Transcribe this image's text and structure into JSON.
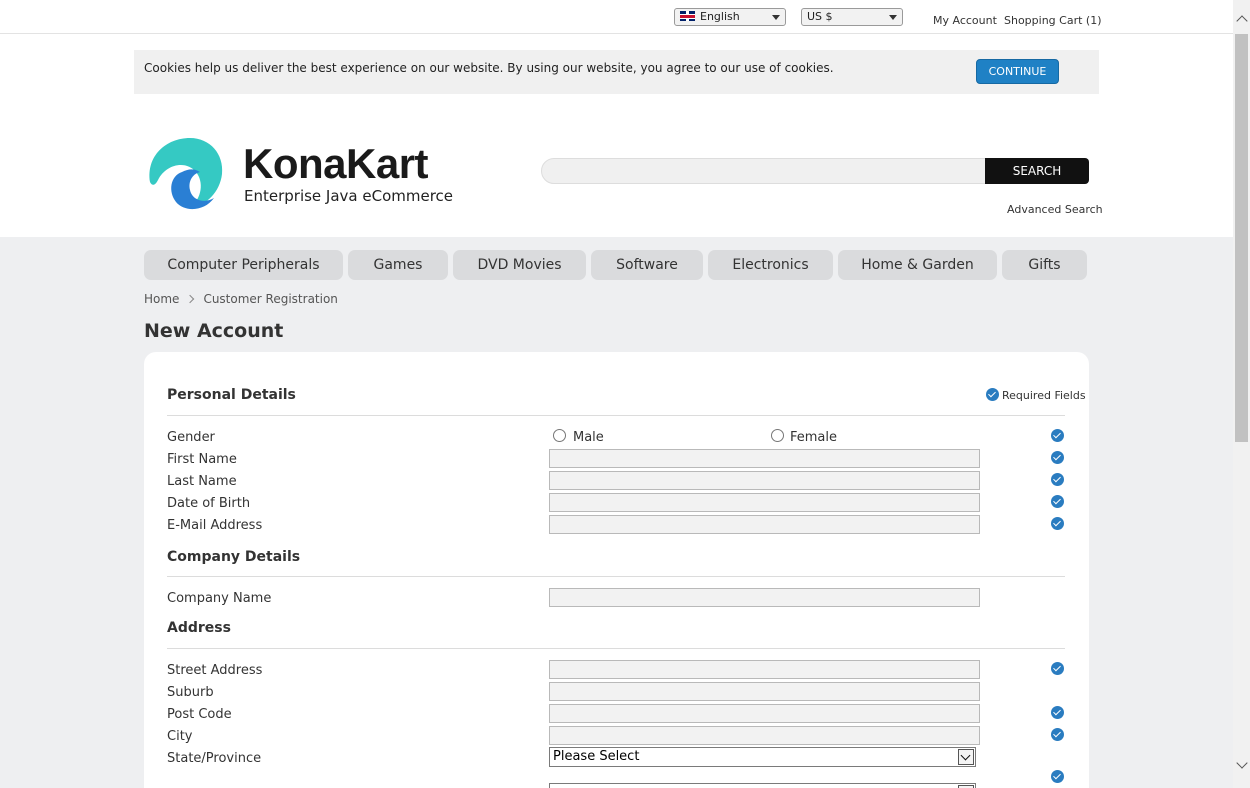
{
  "topbar": {
    "language": "English",
    "currency": "US $",
    "my_account": "My Account",
    "cart": "Shopping Cart (1)"
  },
  "cookie": {
    "message": "Cookies help us deliver the best experience on our website. By using our website, you agree to our use of cookies.",
    "button": "CONTINUE"
  },
  "header": {
    "logo_name": "KonaKart",
    "logo_tagline": "Enterprise Java eCommerce",
    "search_button": "SEARCH",
    "advanced_search": "Advanced Search"
  },
  "categories": [
    "Computer Peripherals",
    "Games",
    "DVD Movies",
    "Software",
    "Electronics",
    "Home & Garden",
    "Gifts"
  ],
  "breadcrumb": [
    "Home",
    "Customer Registration"
  ],
  "page_title": "New Account",
  "form": {
    "required_fields": "Required Fields",
    "personal": {
      "title": "Personal Details",
      "gender": "Gender",
      "male": "Male",
      "female": "Female",
      "first_name": "First Name",
      "last_name": "Last Name",
      "dob": "Date of Birth",
      "email": "E-Mail Address"
    },
    "company": {
      "title": "Company Details",
      "name": "Company Name"
    },
    "address": {
      "title": "Address",
      "street": "Street Address",
      "suburb": "Suburb",
      "post_code": "Post Code",
      "city": "City",
      "state": "State/Province",
      "state_value": "Please Select"
    }
  },
  "colors": {
    "accent": "#1f81c5",
    "check": "#2a7cc0",
    "logo_light": "#35c9c3",
    "logo_dark": "#2a7fd4"
  }
}
